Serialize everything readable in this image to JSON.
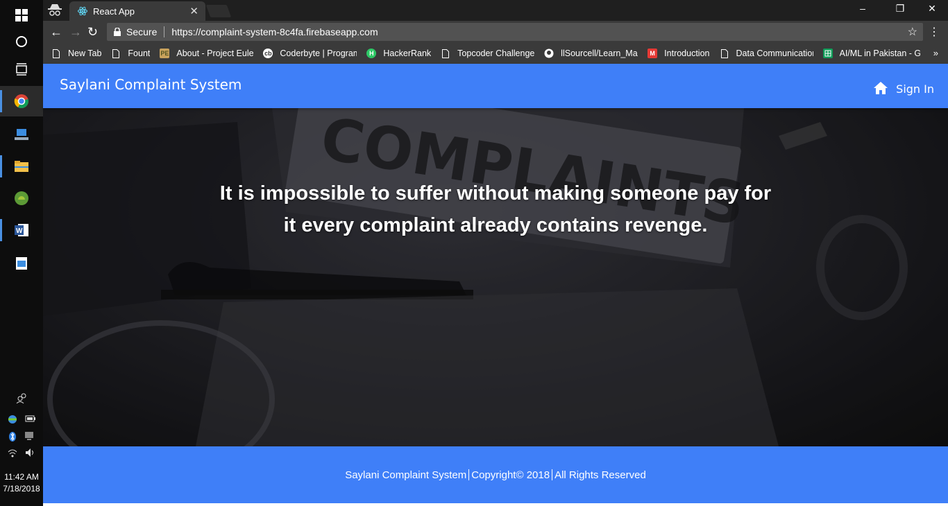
{
  "taskbar": {
    "clock_time": "11:42 AM",
    "clock_date": "7/18/2018"
  },
  "browser": {
    "tab_title": "React App",
    "secure_label": "Secure",
    "url": "https://complaint-system-8c4fa.firebaseapp.com",
    "bookmarks": [
      {
        "label": "New Tab",
        "icon": "page-icon"
      },
      {
        "label": "Fount",
        "icon": "page-icon"
      },
      {
        "label": "About - Project Euler",
        "icon": "project-euler-icon"
      },
      {
        "label": "Coderbyte | Program",
        "icon": "coderbyte-icon"
      },
      {
        "label": "HackerRank",
        "icon": "hackerrank-icon"
      },
      {
        "label": "Topcoder Challenges",
        "icon": "page-icon"
      },
      {
        "label": "llSourcell/Learn_Mac",
        "icon": "github-icon"
      },
      {
        "label": "Introduction",
        "icon": "m-icon"
      },
      {
        "label": "Data Communication",
        "icon": "page-icon"
      },
      {
        "label": "AI/ML in Pakistan - G",
        "icon": "sheets-icon"
      }
    ]
  },
  "app": {
    "brand": "Saylani Complaint System",
    "signin_label": "Sign In",
    "quote_line1": "It is impossible to suffer without making someone pay for",
    "quote_line2": "it every complaint already contains revenge.",
    "footer_part1": "Saylani Complaint System",
    "footer_part2": "Copyright© 2018",
    "footer_part3": "All Rights Reserved",
    "hero_image_text": "COMPLAINTS"
  },
  "colors": {
    "primary": "#3f7ff8"
  }
}
